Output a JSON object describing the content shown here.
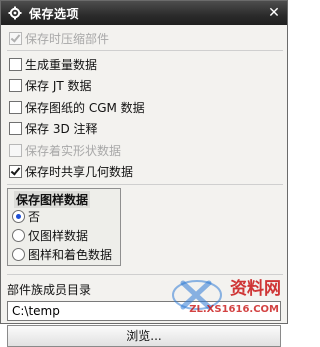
{
  "window": {
    "title": "保存选项",
    "close_glyph": "✕"
  },
  "options": [
    {
      "label": "保存时压缩部件",
      "checked": true,
      "disabled": true
    },
    {
      "label": "生成重量数据",
      "checked": false,
      "disabled": false
    },
    {
      "label": "保存 JT 数据",
      "checked": false,
      "disabled": false
    },
    {
      "label": "保存图纸的 CGM 数据",
      "checked": false,
      "disabled": false
    },
    {
      "label": "保存 3D 注释",
      "checked": false,
      "disabled": false
    },
    {
      "label": "保存着实形状数据",
      "checked": false,
      "disabled": true
    },
    {
      "label": "保存时共享几何数据",
      "checked": true,
      "disabled": false
    }
  ],
  "drawing_group": {
    "title": "保存图样数据",
    "selected_index": 0,
    "radios": [
      "否",
      "仅图样数据",
      "图样和着色数据"
    ]
  },
  "component_dir": {
    "label": "部件族成员目录",
    "value": "C:\\temp",
    "browse_label": "浏览..."
  },
  "watermark": {
    "text": "资料网",
    "subtext": "ZL.XS1616.COM",
    "color": "#c81414"
  }
}
